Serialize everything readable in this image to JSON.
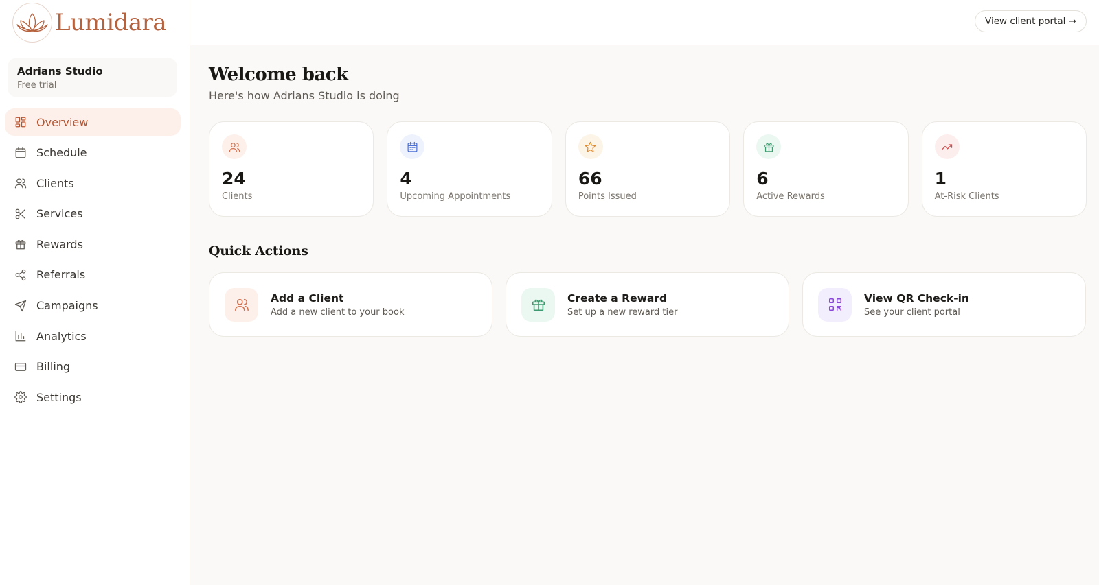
{
  "app": {
    "brand": "Lumidara",
    "brand_color": "#b5623f"
  },
  "studio": {
    "name": "Adrians Studio",
    "plan": "Free trial"
  },
  "sidebar": {
    "items": [
      {
        "label": "Overview",
        "icon": "grid-icon",
        "active": true
      },
      {
        "label": "Schedule",
        "icon": "calendar-icon"
      },
      {
        "label": "Clients",
        "icon": "users-icon"
      },
      {
        "label": "Services",
        "icon": "scissors-icon"
      },
      {
        "label": "Rewards",
        "icon": "gift-icon"
      },
      {
        "label": "Referrals",
        "icon": "share-icon"
      },
      {
        "label": "Campaigns",
        "icon": "send-icon"
      },
      {
        "label": "Analytics",
        "icon": "bar-chart-icon"
      },
      {
        "label": "Billing",
        "icon": "credit-card-icon"
      },
      {
        "label": "Settings",
        "icon": "gear-icon"
      }
    ]
  },
  "header": {
    "portal_button": "View client portal →"
  },
  "main": {
    "title": "Welcome back",
    "subtitle": "Here's how Adrians Studio is doing",
    "stats": [
      {
        "value": "24",
        "label": "Clients",
        "icon": "users-icon",
        "color": "#d2714f",
        "bg": "#fdf0ea"
      },
      {
        "value": "4",
        "label": "Upcoming Appointments",
        "icon": "calendar-icon",
        "color": "#4a6fd6",
        "bg": "#eef2fd"
      },
      {
        "value": "66",
        "label": "Points Issued",
        "icon": "star-icon",
        "color": "#e08a2c",
        "bg": "#fdf4e8"
      },
      {
        "value": "6",
        "label": "Active Rewards",
        "icon": "gift-icon",
        "color": "#3c9a6e",
        "bg": "#ebf7f1"
      },
      {
        "value": "1",
        "label": "At-Risk Clients",
        "icon": "trending-up-icon",
        "color": "#d24a4a",
        "bg": "#fdeeee"
      }
    ],
    "quick_actions_title": "Quick Actions",
    "actions": [
      {
        "title": "Add a Client",
        "subtitle": "Add a new client to your book",
        "icon": "users-icon",
        "color": "#d2714f",
        "bg": "#fdf0ea"
      },
      {
        "title": "Create a Reward",
        "subtitle": "Set up a new reward tier",
        "icon": "gift-icon",
        "color": "#3c9a6e",
        "bg": "#ebf7f1"
      },
      {
        "title": "View QR Check-in",
        "subtitle": "See your client portal",
        "icon": "qr-code-icon",
        "color": "#8a4ad6",
        "bg": "#f3eefd"
      }
    ]
  }
}
